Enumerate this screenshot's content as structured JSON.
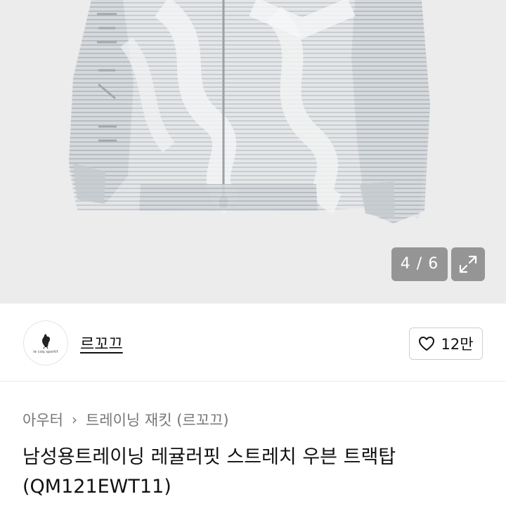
{
  "gallery": {
    "counter": "4 / 6",
    "current_image": 4,
    "total_images": 6
  },
  "store": {
    "logo_text": "le coq sportif",
    "name": "르꼬끄",
    "likes": "12만"
  },
  "breadcrumb": {
    "items": [
      "아우터",
      "트레이닝 재킷 (르꼬끄)"
    ]
  },
  "product": {
    "title": "남성용트레이닝 레귤러핏 스트레치 우븐 트랙탑 (QM121EWT11)"
  },
  "colors": {
    "overlay": "#737373",
    "divider": "#eeeeee",
    "text_primary": "#111111",
    "text_secondary": "#777777"
  }
}
